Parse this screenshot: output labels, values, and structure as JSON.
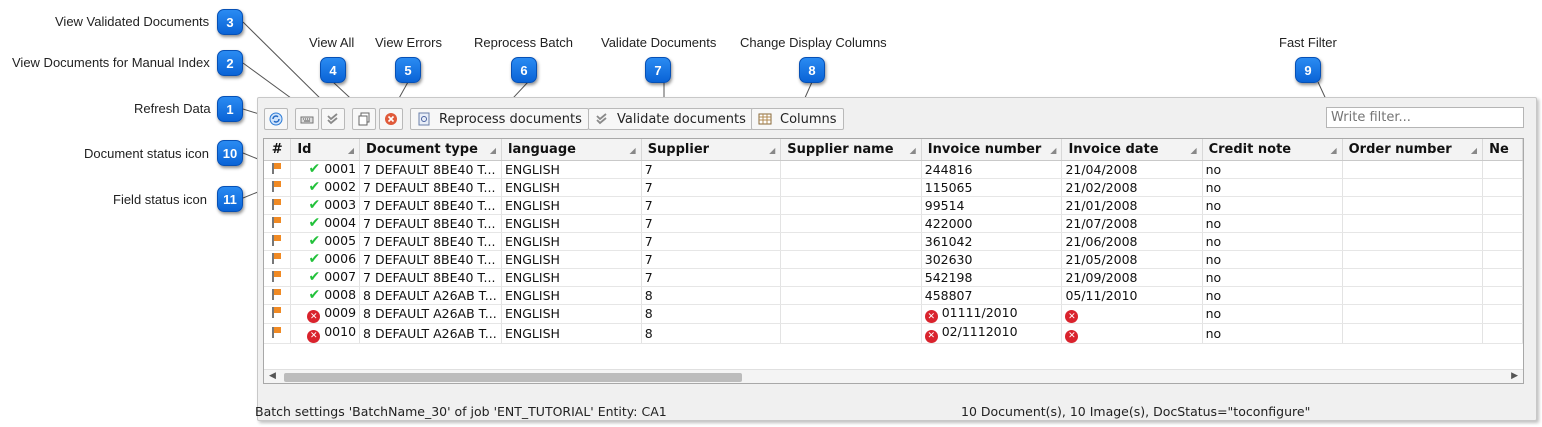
{
  "callouts": [
    {
      "num": "1",
      "label": "Refresh Data"
    },
    {
      "num": "2",
      "label": "View Documents for Manual Index"
    },
    {
      "num": "3",
      "label": "View Validated Documents"
    },
    {
      "num": "4",
      "label": "View All"
    },
    {
      "num": "5",
      "label": "View Errors"
    },
    {
      "num": "6",
      "label": "Reprocess Batch"
    },
    {
      "num": "7",
      "label": "Validate Documents"
    },
    {
      "num": "8",
      "label": "Change Display Columns"
    },
    {
      "num": "9",
      "label": "Fast Filter"
    },
    {
      "num": "10",
      "label": "Document status icon"
    },
    {
      "num": "11",
      "label": "Field status icon"
    }
  ],
  "toolbar": {
    "refresh_icon": "refresh-icon",
    "manual_index_icon": "keyboard-icon",
    "validated_icon": "double-check-icon",
    "view_all_icon": "copy-pages-icon",
    "errors_icon": "error-icon",
    "reprocess_label": "Reprocess documents",
    "validate_label": "Validate documents",
    "columns_label": "Columns"
  },
  "filter": {
    "placeholder": "Write filter..."
  },
  "grid": {
    "columns": [
      "#",
      "Id",
      "Document type",
      "language",
      "Supplier",
      "Supplier name",
      "Invoice number",
      "Invoice date",
      "Credit note",
      "Order number",
      "Ne"
    ],
    "rows": [
      {
        "status": "ok",
        "id": "0001",
        "doctype": "7 DEFAULT 8BE40 T...",
        "language": "ENGLISH",
        "supplier": "7",
        "supplier_name": "",
        "invoice_number": "244816",
        "invoice_date": "21/04/2008",
        "credit_note": "no",
        "order_number": ""
      },
      {
        "status": "ok",
        "id": "0002",
        "doctype": "7 DEFAULT 8BE40 T...",
        "language": "ENGLISH",
        "supplier": "7",
        "supplier_name": "",
        "invoice_number": "115065",
        "invoice_date": "21/02/2008",
        "credit_note": "no",
        "order_number": ""
      },
      {
        "status": "ok",
        "id": "0003",
        "doctype": "7 DEFAULT 8BE40 T...",
        "language": "ENGLISH",
        "supplier": "7",
        "supplier_name": "",
        "invoice_number": "99514",
        "invoice_date": "21/01/2008",
        "credit_note": "no",
        "order_number": ""
      },
      {
        "status": "ok",
        "id": "0004",
        "doctype": "7 DEFAULT 8BE40 T...",
        "language": "ENGLISH",
        "supplier": "7",
        "supplier_name": "",
        "invoice_number": "422000",
        "invoice_date": "21/07/2008",
        "credit_note": "no",
        "order_number": ""
      },
      {
        "status": "ok",
        "id": "0005",
        "doctype": "7 DEFAULT 8BE40 T...",
        "language": "ENGLISH",
        "supplier": "7",
        "supplier_name": "",
        "invoice_number": "361042",
        "invoice_date": "21/06/2008",
        "credit_note": "no",
        "order_number": ""
      },
      {
        "status": "ok",
        "id": "0006",
        "doctype": "7 DEFAULT 8BE40 T...",
        "language": "ENGLISH",
        "supplier": "7",
        "supplier_name": "",
        "invoice_number": "302630",
        "invoice_date": "21/05/2008",
        "credit_note": "no",
        "order_number": ""
      },
      {
        "status": "ok",
        "id": "0007",
        "doctype": "7 DEFAULT 8BE40 T...",
        "language": "ENGLISH",
        "supplier": "7",
        "supplier_name": "",
        "invoice_number": "542198",
        "invoice_date": "21/09/2008",
        "credit_note": "no",
        "order_number": ""
      },
      {
        "status": "ok",
        "id": "0008",
        "doctype": "8 DEFAULT A26AB T...",
        "language": "ENGLISH",
        "supplier": "8",
        "supplier_name": "",
        "invoice_number": "458807",
        "invoice_date": "05/11/2010",
        "credit_note": "no",
        "order_number": ""
      },
      {
        "status": "error",
        "id": "0009",
        "doctype": "8 DEFAULT A26AB T...",
        "language": "ENGLISH",
        "supplier": "8",
        "supplier_name": "",
        "invoice_number": "01111/2010",
        "invoice_number_error": true,
        "invoice_date": "",
        "invoice_date_error": true,
        "credit_note": "no",
        "order_number": ""
      },
      {
        "status": "error",
        "id": "0010",
        "doctype": "8 DEFAULT A26AB T...",
        "language": "ENGLISH",
        "supplier": "8",
        "supplier_name": "",
        "invoice_number": "02/1112010",
        "invoice_number_error": true,
        "invoice_date": "",
        "invoice_date_error": true,
        "credit_note": "no",
        "order_number": ""
      }
    ]
  },
  "status_bar": {
    "left": "Batch settings 'BatchName_30' of job 'ENT_TUTORIAL' Entity: CA1",
    "right": "10 Document(s), 10 Image(s), DocStatus=\"toconfigure\""
  }
}
